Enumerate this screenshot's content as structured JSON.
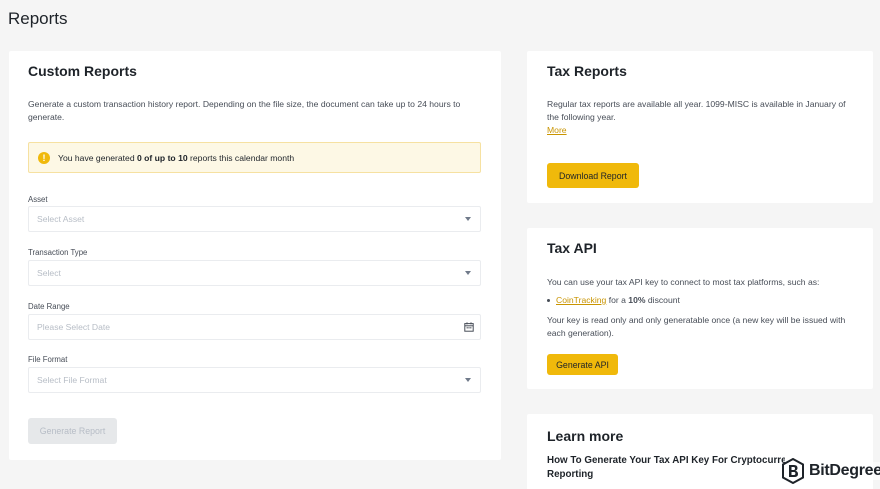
{
  "page": {
    "title": "Reports"
  },
  "custom_reports": {
    "title": "Custom Reports",
    "description": "Generate a custom transaction history report. Depending on the file size, the document can take up to 24 hours to generate.",
    "alert": {
      "prefix": "You have generated ",
      "count_text": "0 of up to 10",
      "suffix": " reports this calendar month"
    },
    "asset": {
      "label": "Asset",
      "placeholder": "Select Asset"
    },
    "transaction_type": {
      "label": "Transaction Type",
      "placeholder": "Select"
    },
    "date_range": {
      "label": "Date Range",
      "placeholder": "Please Select Date"
    },
    "file_format": {
      "label": "File Format",
      "placeholder": "Select File Format"
    },
    "generate_button": "Generate Report"
  },
  "tax_reports": {
    "title": "Tax Reports",
    "description": "Regular tax reports are available all year. 1099-MISC is available in January of the following year.",
    "more_link": "More",
    "download_button": "Download Report"
  },
  "tax_api": {
    "title": "Tax API",
    "intro": "You can use your tax API key to connect to most tax platforms, such as:",
    "bullet": {
      "link": "CoinTracking",
      "middle": " for a ",
      "discount": "10%",
      "suffix": " discount"
    },
    "note": "Your key is read only and only generatable once (a new key will be issued with each generation).",
    "generate_button": "Generate API"
  },
  "learn_more": {
    "title": "Learn more",
    "article_title": "How To Generate Your Tax API Key For Cryptocurrency Tax Reporting"
  },
  "watermark": {
    "text": "BitDegree"
  },
  "colors": {
    "accent": "#f0b90b",
    "link": "#c99400",
    "alert_bg": "#fdf8e5"
  }
}
